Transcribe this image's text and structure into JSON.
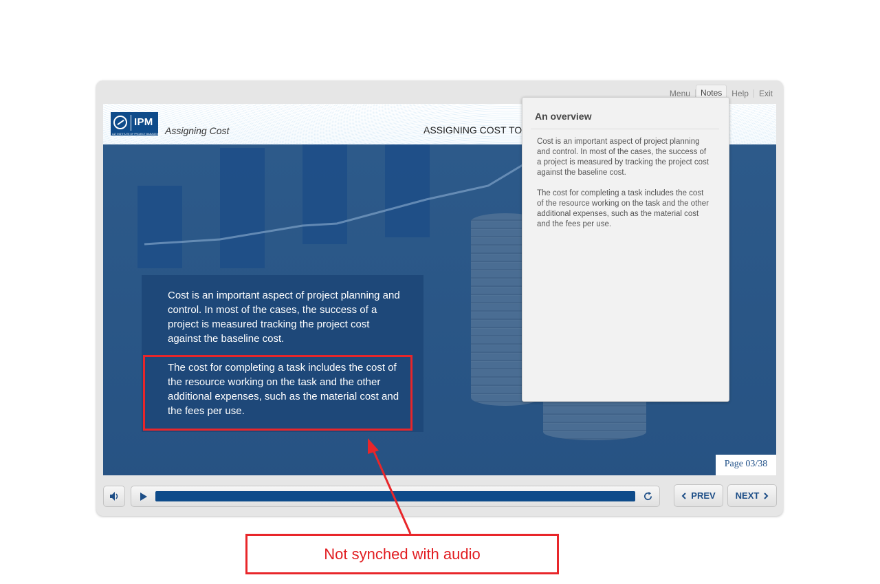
{
  "topnav": {
    "menu": "Menu",
    "notes": "Notes",
    "help": "Help",
    "exit": "Exit"
  },
  "header": {
    "logo_text": "IPM",
    "logo_subtext": "L&T INSTITUTE OF PROJECT MANAGEMENT",
    "course_title": "Assigning Cost",
    "page_heading": "ASSIGNING COST TO T"
  },
  "slide": {
    "paragraph1": "Cost is an important aspect of project planning and control. In most of the cases, the success of a project is measured tracking the project cost against the baseline cost.",
    "paragraph2": "The cost for completing a task includes the cost of the  resource working on the task and the other additional expenses, such as the material cost and the fees per use.",
    "page_counter": "Page 03/38"
  },
  "notes": {
    "title": "An overview",
    "paragraph1": "Cost is an important aspect of project planning and control. In most of the cases, the success of a project is measured by tracking the project cost against the baseline cost.",
    "paragraph2": "The cost for completing a task includes the cost of the resource working on the task and the other additional expenses, such as the material cost and the fees per use."
  },
  "controls": {
    "prev_label": "PREV",
    "next_label": "NEXT",
    "progress_fraction": 1.0,
    "volume_icon": "speaker-icon",
    "play_icon": "play-icon",
    "replay_icon": "replay-icon"
  },
  "annotation": {
    "callout_text": "Not synched with audio",
    "color": "#e8262a"
  },
  "colors": {
    "brand_blue": "#0e4b8a",
    "slide_bg": "#2d5a8a",
    "frame": "#e6e6e6"
  }
}
